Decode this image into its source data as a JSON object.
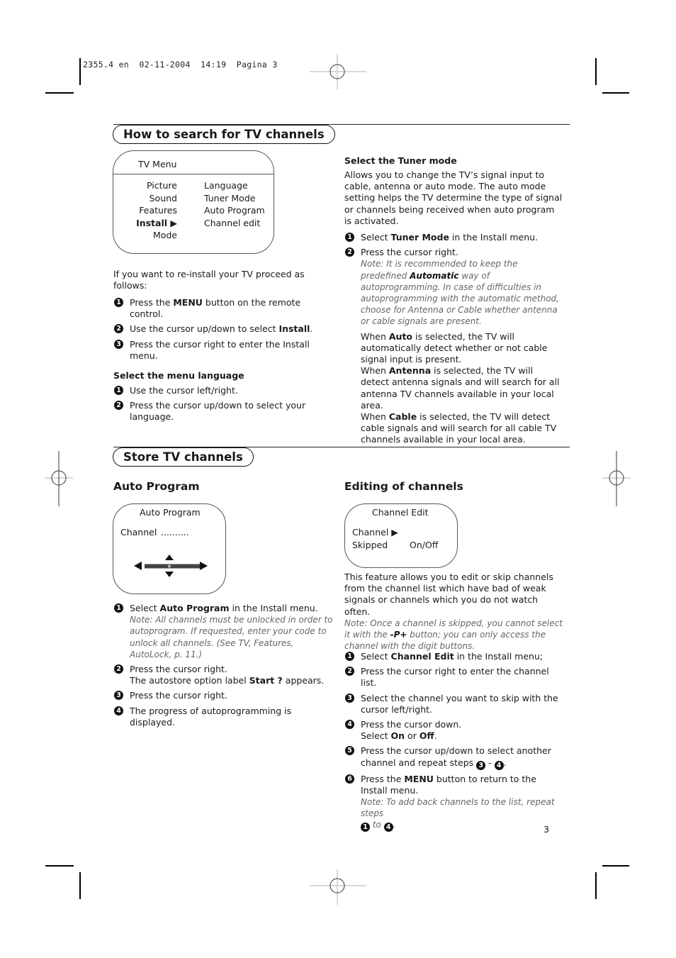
{
  "print_header": {
    "job": "2355.4 en",
    "date": "02-11-2004",
    "time": "14:19",
    "page_label": "Pagina 3"
  },
  "section1": {
    "title": "How to search for  TV channels",
    "tv_menu": {
      "title": "TV Menu",
      "left_items": [
        "Picture",
        "Sound",
        "Features",
        "Install ▶",
        "Mode"
      ],
      "right_items": [
        "Language",
        "Tuner Mode",
        "Auto Program",
        "Channel edit"
      ]
    },
    "intro": "If you want to re-install your TV proceed as follows:",
    "steps": [
      {
        "n": "1",
        "pre": "Press the ",
        "bold": "MENU",
        "post": " button on the remote control."
      },
      {
        "n": "2",
        "pre": "Use the cursor up/down to select ",
        "bold": "Install",
        "post": "."
      },
      {
        "n": "3",
        "pre": "Press the cursor right to enter the Install menu.",
        "bold": "",
        "post": ""
      }
    ],
    "language": {
      "heading": "Select the menu language",
      "steps": [
        {
          "n": "1",
          "text": "Use the cursor left/right."
        },
        {
          "n": "2",
          "text": "Press the cursor up/down to select your language."
        }
      ]
    },
    "tuner": {
      "heading": "Select the Tuner mode",
      "intro": "Allows you to change the TV’s signal input to cable, antenna or auto mode. The auto mode setting helps the TV determine the type of signal or channels being received when auto program is activated.",
      "step1": {
        "n": "1",
        "pre": "Select ",
        "bold": "Tuner Mode",
        "post": " in the Install menu."
      },
      "step2": {
        "n": "2",
        "text": "Press the cursor right."
      },
      "note_pre": "Note: It is recommended to keep the predefined ",
      "note_bold": "Automatic",
      "note_post": " way of autoprogramming.  In case of difficulties in autoprogramming with the automatic method, choose for Antenna or Cable whether antenna or cable signals are present.",
      "modes": [
        {
          "pre": "When ",
          "bold": "Auto",
          "post": " is selected, the TV will automatically detect whether or not cable signal input is present."
        },
        {
          "pre": "When ",
          "bold": "Antenna",
          "post": " is selected, the TV will detect antenna signals and will search for all antenna TV channels available in your local area."
        },
        {
          "pre": "When ",
          "bold": "Cable",
          "post": " is selected, the TV will detect cable signals and will search for all cable TV channels available in your local area."
        }
      ]
    }
  },
  "section2": {
    "title": "Store TV channels",
    "auto_program": {
      "heading": "Auto Program",
      "box_title": "Auto Program",
      "channel_label": "Channel",
      "channel_value": "..........",
      "steps": [
        {
          "n": "1",
          "pre": "Select ",
          "bold": "Auto Program",
          "post": " in the Install menu.",
          "note": "Note: All channels must be unlocked in order to autoprogram. If requested, enter your code to unlock all channels. (See TV, Features, AutoLock, p. 11.)"
        },
        {
          "n": "2",
          "pre": "Press the cursor right.",
          "line2_pre": "The autostore option label ",
          "line2_bold": "Start ?",
          "line2_post": " appears."
        },
        {
          "n": "3",
          "text": "Press the cursor right."
        },
        {
          "n": "4",
          "text": "The progress of autoprogramming is displayed."
        }
      ]
    },
    "editing": {
      "heading": "Editing of channels",
      "box_title": "Channel Edit",
      "row1_label": "Channel ▶",
      "row2_label": "Skipped",
      "row2_value": "On/Off",
      "intro": "This feature allows you to edit or skip channels from the channel list which have bad of weak signals or channels which you do not watch often.",
      "note_pre": "Note: Once a channel is skipped, you cannot select it with the ",
      "note_bold": "-P+",
      "note_post": " button; you can only access the channel with the digit buttons.",
      "steps": [
        {
          "n": "1",
          "pre": "Select ",
          "bold": "Channel Edit",
          "post": " in the Install menu;"
        },
        {
          "n": "2",
          "text": "Press the cursor right to enter the channel list."
        },
        {
          "n": "3",
          "text": "Select the channel you want to skip with the cursor left/right."
        },
        {
          "n": "4",
          "text": "Press the cursor down.",
          "l2_pre": "Select ",
          "l2_b1": "On",
          "l2_mid": " or ",
          "l2_b2": "Off",
          "l2_post": "."
        },
        {
          "n": "5",
          "text": "Press the cursor up/down to select another channel and repeat steps ",
          "ref_a": "3",
          "dash": " - ",
          "ref_b": "4",
          "end": "."
        },
        {
          "n": "6",
          "pre": "Press the ",
          "bold": "MENU",
          "post": " button to return to the Install menu.",
          "note": "Note: To add back channels to the list, repeat steps ",
          "ref_a": "1",
          "to": " to ",
          "ref_b": "4",
          "end": "."
        }
      ]
    }
  },
  "page_number": "3"
}
